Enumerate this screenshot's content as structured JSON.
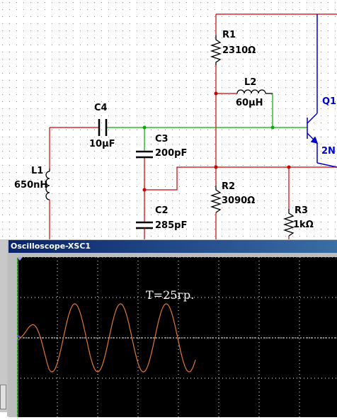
{
  "schematic": {
    "components": [
      {
        "ref": "R1",
        "value": "2310Ω"
      },
      {
        "ref": "L2",
        "value": "60µH"
      },
      {
        "ref": "Q1",
        "value": "2N"
      },
      {
        "ref": "C4",
        "value": "10µF"
      },
      {
        "ref": "C3",
        "value": "200pF"
      },
      {
        "ref": "L1",
        "value": "650nH"
      },
      {
        "ref": "R2",
        "value": "3090Ω"
      },
      {
        "ref": "C2",
        "value": "285pF"
      },
      {
        "ref": "R3",
        "value": "1kΩ"
      }
    ],
    "q1_ref": "Q1",
    "q1_partial": "2N"
  },
  "oscilloscope": {
    "title": "Oscilloscope-XSC1",
    "annotation": "T=25гр.",
    "trace_color": "#e07830",
    "grid_color": "#ffffff",
    "screen_color": "#000000",
    "cycles_visible": 4
  },
  "colors": {
    "wire_red": "#d00000",
    "wire_green": "#00b000",
    "wire_blue": "#0000cc",
    "component": "#000000"
  }
}
